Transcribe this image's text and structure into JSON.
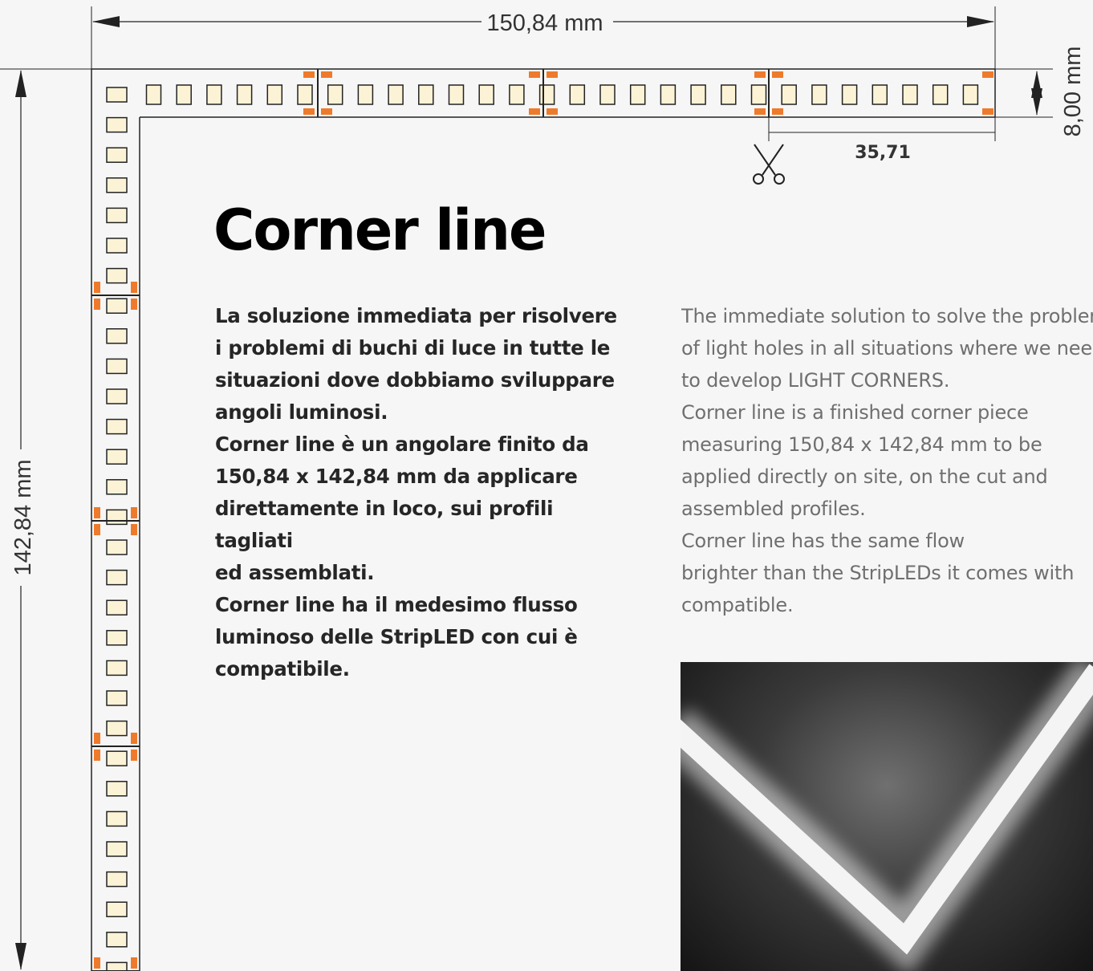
{
  "drawing": {
    "width_label": "150,84 mm",
    "height_label": "142,84 mm",
    "strip_width_label": "8,00 mm",
    "cut_spacing_label": "35,71"
  },
  "title": "Corner line",
  "italian_paragraphs": [
    [
      "La soluzione immediata per risolvere",
      "i problemi di buchi di luce in tutte le",
      "situazioni dove dobbiamo sviluppare",
      "angoli luminosi."
    ],
    [
      "Corner line è un angolare finito da",
      "150,84 x 142,84 mm da applicare",
      "direttamente in loco, sui profili tagliati",
      "ed assemblati."
    ],
    [
      "Corner line ha il medesimo flusso",
      "luminoso delle StripLED con cui è",
      "compatibile."
    ]
  ],
  "english_paragraphs": [
    [
      "The immediate solution to solve the problem",
      "of light holes in all situations where we need",
      "to develop LIGHT CORNERS."
    ],
    [
      "Corner line is a finished corner piece",
      "measuring 150,84 x 142,84 mm to be",
      "applied directly on site, on the cut and",
      "assembled profiles."
    ],
    [
      "Corner line has the same flow",
      "brighter than the StripLEDs it comes with",
      "compatible."
    ]
  ],
  "colors": {
    "led_fill": "#fcf3d6",
    "pad_orange": "#ee7a2b",
    "line": "#222222",
    "text_gray": "#6f6f6f"
  },
  "icons": [
    "scissors-icon",
    "arrow-icon"
  ]
}
